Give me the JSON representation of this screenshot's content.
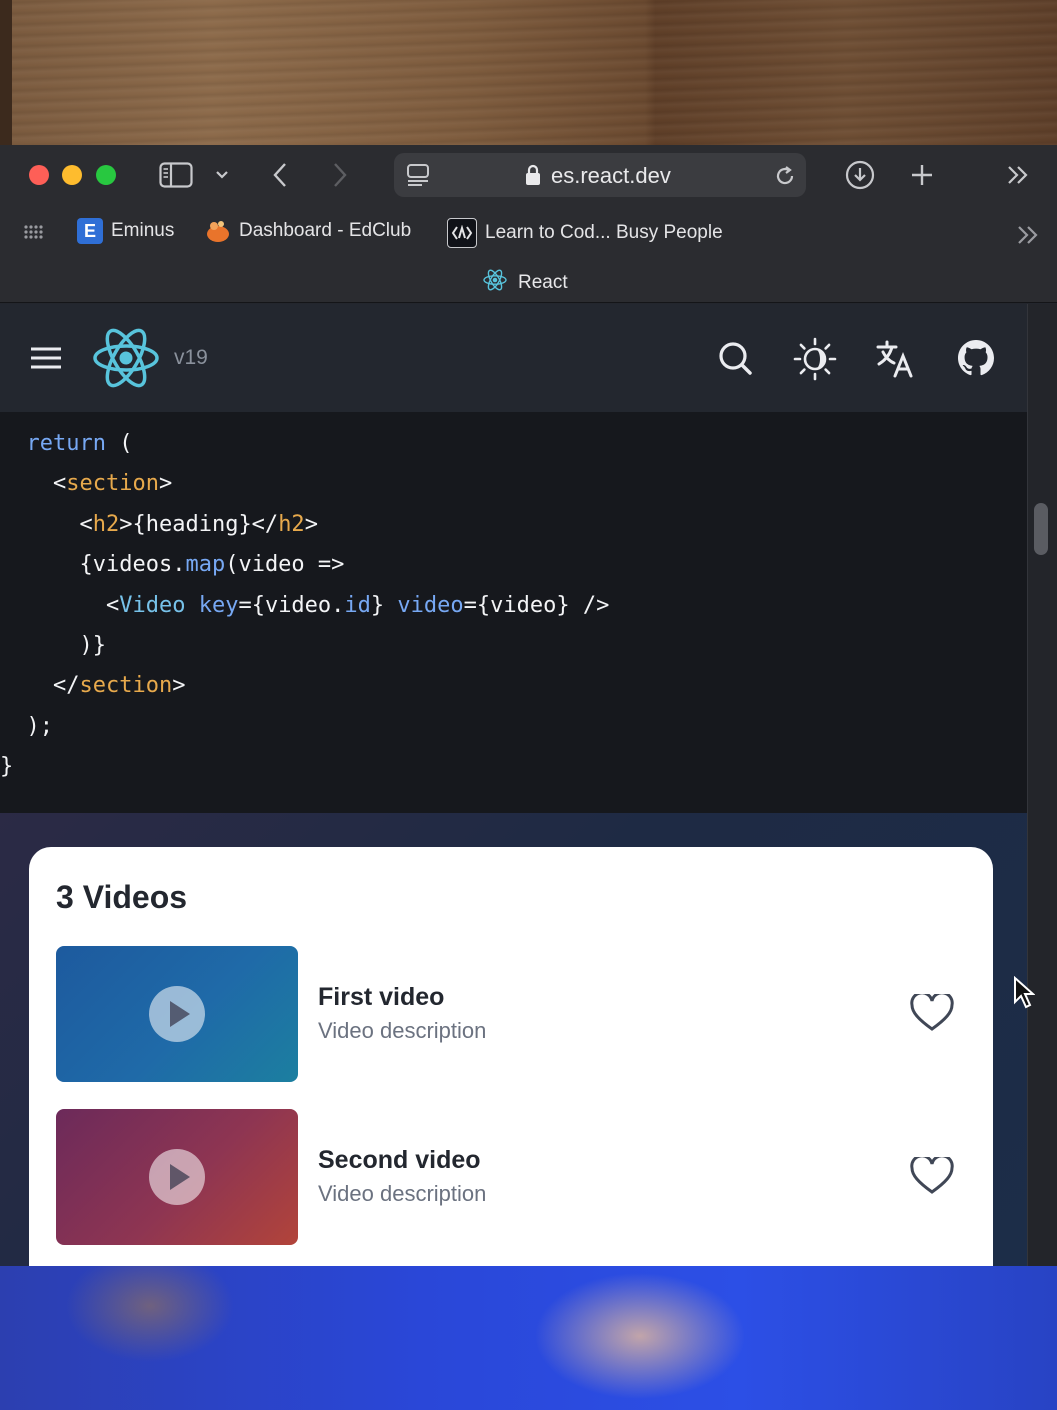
{
  "browser": {
    "url": "es.react.dev",
    "tab_title": "React",
    "bookmarks": [
      {
        "label": "Eminus",
        "icon": "E"
      },
      {
        "label": "Dashboard - EdClub",
        "icon": "edclub-logo"
      },
      {
        "label": "Learn to Cod... Busy People",
        "icon": "code-logo"
      }
    ]
  },
  "site": {
    "version": "v19"
  },
  "code_lines": [
    "return (",
    "<section>",
    "<h2>{heading}</h2>",
    "{videos.map(video =>",
    "<Video key={video.id} video={video} />",
    ")}",
    "</section>",
    ");",
    "}"
  ],
  "preview": {
    "title": "3 Videos",
    "videos": [
      {
        "title": "First video",
        "description": "Video description"
      },
      {
        "title": "Second video",
        "description": "Video description"
      }
    ]
  },
  "colors": {
    "react_blue": "#58c4dc",
    "code_keyword": "#77a8f3",
    "code_tag": "#e7a94c"
  }
}
